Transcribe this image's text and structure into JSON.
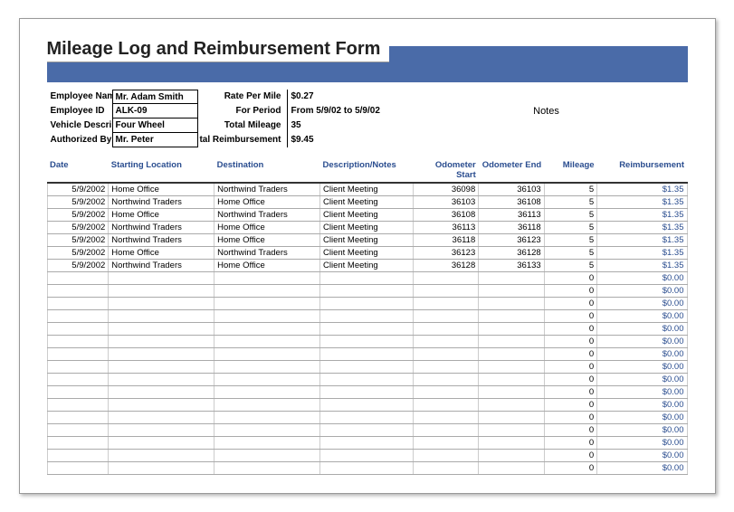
{
  "title": "Mileage Log and Reimbursement Form",
  "header_labels": {
    "employee_name": "Employee Nam",
    "employee_id": "Employee ID",
    "vehicle_desc": "Vehicle Descri",
    "authorized_by": "Authorized By",
    "rate_per_mile": "Rate Per Mile",
    "for_period": "For Period",
    "total_mileage": "Total Mileage",
    "total_reimbursement": "tal Reimbursement",
    "notes": "Notes"
  },
  "header_values": {
    "employee_name": "Mr. Adam Smith",
    "employee_id": "ALK-09",
    "vehicle_desc": "Four Wheel",
    "authorized_by": "Mr. Peter",
    "rate_per_mile": "$0.27",
    "for_period": "From 5/9/02 to 5/9/02",
    "total_mileage": "35",
    "total_reimbursement": "$9.45"
  },
  "columns": {
    "date": "Date",
    "start": "Starting Location",
    "dest": "Destination",
    "desc": "Description/Notes",
    "ostart": "Odometer Start",
    "oend": "Odometer End",
    "mileage": "Mileage",
    "reimb": "Reimbursement"
  },
  "chart_data": {
    "type": "table",
    "rows": [
      {
        "date": "5/9/2002",
        "start": "Home Office",
        "dest": "Northwind Traders",
        "desc": "Client Meeting",
        "ostart": "36098",
        "oend": "36103",
        "mileage": "5",
        "reimb": "$1.35"
      },
      {
        "date": "5/9/2002",
        "start": "Northwind Traders",
        "dest": "Home Office",
        "desc": "Client Meeting",
        "ostart": "36103",
        "oend": "36108",
        "mileage": "5",
        "reimb": "$1.35"
      },
      {
        "date": "5/9/2002",
        "start": "Home Office",
        "dest": "Northwind Traders",
        "desc": "Client Meeting",
        "ostart": "36108",
        "oend": "36113",
        "mileage": "5",
        "reimb": "$1.35"
      },
      {
        "date": "5/9/2002",
        "start": "Northwind Traders",
        "dest": "Home Office",
        "desc": "Client Meeting",
        "ostart": "36113",
        "oend": "36118",
        "mileage": "5",
        "reimb": "$1.35"
      },
      {
        "date": "5/9/2002",
        "start": "Northwind Traders",
        "dest": "Home Office",
        "desc": "Client Meeting",
        "ostart": "36118",
        "oend": "36123",
        "mileage": "5",
        "reimb": "$1.35"
      },
      {
        "date": "5/9/2002",
        "start": "Home Office",
        "dest": "Northwind Traders",
        "desc": "Client Meeting",
        "ostart": "36123",
        "oend": "36128",
        "mileage": "5",
        "reimb": "$1.35"
      },
      {
        "date": "5/9/2002",
        "start": "Northwind Traders",
        "dest": "Home Office",
        "desc": "Client Meeting",
        "ostart": "36128",
        "oend": "36133",
        "mileage": "5",
        "reimb": "$1.35"
      },
      {
        "date": "",
        "start": "",
        "dest": "",
        "desc": "",
        "ostart": "",
        "oend": "",
        "mileage": "0",
        "reimb": "$0.00"
      },
      {
        "date": "",
        "start": "",
        "dest": "",
        "desc": "",
        "ostart": "",
        "oend": "",
        "mileage": "0",
        "reimb": "$0.00"
      },
      {
        "date": "",
        "start": "",
        "dest": "",
        "desc": "",
        "ostart": "",
        "oend": "",
        "mileage": "0",
        "reimb": "$0.00"
      },
      {
        "date": "",
        "start": "",
        "dest": "",
        "desc": "",
        "ostart": "",
        "oend": "",
        "mileage": "0",
        "reimb": "$0.00"
      },
      {
        "date": "",
        "start": "",
        "dest": "",
        "desc": "",
        "ostart": "",
        "oend": "",
        "mileage": "0",
        "reimb": "$0.00"
      },
      {
        "date": "",
        "start": "",
        "dest": "",
        "desc": "",
        "ostart": "",
        "oend": "",
        "mileage": "0",
        "reimb": "$0.00"
      },
      {
        "date": "",
        "start": "",
        "dest": "",
        "desc": "",
        "ostart": "",
        "oend": "",
        "mileage": "0",
        "reimb": "$0.00"
      },
      {
        "date": "",
        "start": "",
        "dest": "",
        "desc": "",
        "ostart": "",
        "oend": "",
        "mileage": "0",
        "reimb": "$0.00"
      },
      {
        "date": "",
        "start": "",
        "dest": "",
        "desc": "",
        "ostart": "",
        "oend": "",
        "mileage": "0",
        "reimb": "$0.00"
      },
      {
        "date": "",
        "start": "",
        "dest": "",
        "desc": "",
        "ostart": "",
        "oend": "",
        "mileage": "0",
        "reimb": "$0.00"
      },
      {
        "date": "",
        "start": "",
        "dest": "",
        "desc": "",
        "ostart": "",
        "oend": "",
        "mileage": "0",
        "reimb": "$0.00"
      },
      {
        "date": "",
        "start": "",
        "dest": "",
        "desc": "",
        "ostart": "",
        "oend": "",
        "mileage": "0",
        "reimb": "$0.00"
      },
      {
        "date": "",
        "start": "",
        "dest": "",
        "desc": "",
        "ostart": "",
        "oend": "",
        "mileage": "0",
        "reimb": "$0.00"
      },
      {
        "date": "",
        "start": "",
        "dest": "",
        "desc": "",
        "ostart": "",
        "oend": "",
        "mileage": "0",
        "reimb": "$0.00"
      },
      {
        "date": "",
        "start": "",
        "dest": "",
        "desc": "",
        "ostart": "",
        "oend": "",
        "mileage": "0",
        "reimb": "$0.00"
      },
      {
        "date": "",
        "start": "",
        "dest": "",
        "desc": "",
        "ostart": "",
        "oend": "",
        "mileage": "0",
        "reimb": "$0.00"
      }
    ]
  }
}
